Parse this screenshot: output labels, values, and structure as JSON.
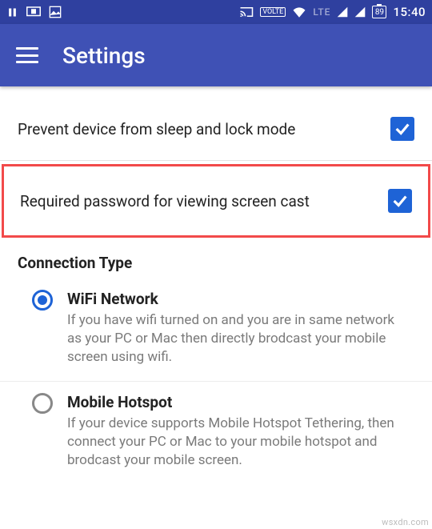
{
  "statusbar": {
    "time": "15:40",
    "lte": "LTE",
    "volte": "VOLTE",
    "battery": "89"
  },
  "appbar": {
    "title": "Settings"
  },
  "settings": {
    "prevent_sleep": {
      "label": "Prevent device from sleep and lock mode",
      "checked": true
    },
    "require_password": {
      "label": "Required password for viewing screen cast",
      "checked": true
    }
  },
  "connection": {
    "heading": "Connection Type",
    "options": [
      {
        "key": "wifi",
        "title": "WiFi Network",
        "desc": "If you have wifi turned on and you are in same network as your PC or Mac then directly brodcast your mobile screen using wifi.",
        "selected": true
      },
      {
        "key": "hotspot",
        "title": "Mobile Hotspot",
        "desc": "If your device supports Mobile Hotspot Tethering, then connect your PC or Mac to your mobile hotspot and brodcast your mobile screen.",
        "selected": false
      }
    ]
  },
  "watermark": "wsxdn.com"
}
